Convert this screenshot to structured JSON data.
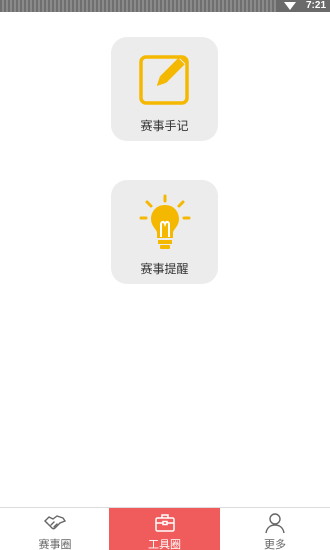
{
  "status_bar": {
    "time": "7:21"
  },
  "tools": [
    {
      "label": "赛事手记",
      "icon": "edit-note-icon"
    },
    {
      "label": "赛事提醒",
      "icon": "lightbulb-icon"
    }
  ],
  "bottom_nav": {
    "items": [
      {
        "label": "赛事圈",
        "icon": "handshake-icon",
        "active": false
      },
      {
        "label": "工具圈",
        "icon": "toolbox-icon",
        "active": true
      },
      {
        "label": "更多",
        "icon": "user-icon",
        "active": false
      }
    ]
  },
  "colors": {
    "accent": "#f5b800",
    "nav_active": "#f05b5b",
    "card_bg": "#ececec"
  }
}
